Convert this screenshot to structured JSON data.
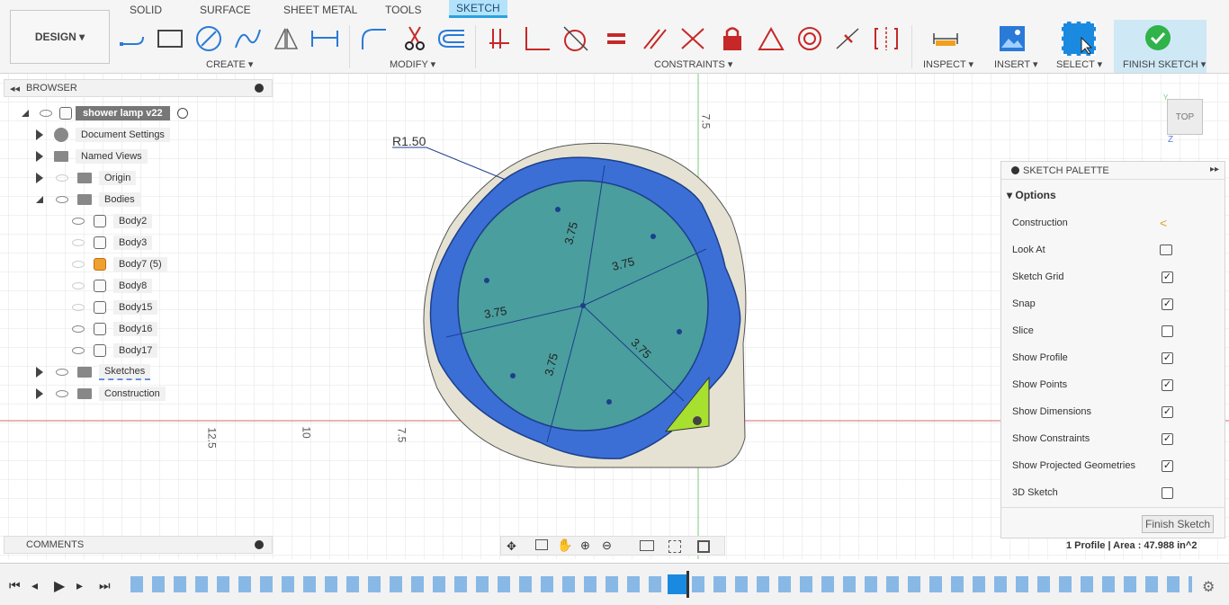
{
  "ribbon": {
    "workspace_button": "DESIGN ▾",
    "tabs": [
      "SOLID",
      "SURFACE",
      "SHEET METAL",
      "TOOLS",
      "SKETCH"
    ],
    "groups": {
      "create": "CREATE ▾",
      "modify": "MODIFY ▾",
      "constraints": "CONSTRAINTS ▾",
      "inspect": "INSPECT ▾",
      "insert": "INSERT ▾",
      "select": "SELECT ▾",
      "finish": "FINISH SKETCH ▾"
    }
  },
  "browser": {
    "title": "BROWSER",
    "root": "shower lamp v22",
    "items": [
      "Document Settings",
      "Named Views",
      "Origin",
      "Bodies"
    ],
    "bodies": [
      "Body2",
      "Body3",
      "Body7 (5)",
      "Body8",
      "Body15",
      "Body16",
      "Body17"
    ],
    "after": [
      "Sketches",
      "Construction"
    ]
  },
  "comments": {
    "title": "COMMENTS"
  },
  "canvas": {
    "radius_label": "R1.50",
    "dim_labels": [
      "3.75",
      "3.75",
      "3.75",
      "3.75",
      "3.75"
    ],
    "axis_labels": [
      "12.5",
      "10",
      "7.5",
      "7.5"
    ],
    "viewcube_label": "TOP",
    "viewcube_axes": [
      "Y",
      "Z"
    ]
  },
  "sketch_palette": {
    "title": "SKETCH PALETTE",
    "section": "Options",
    "rows": [
      {
        "label": "Construction",
        "type": "icon"
      },
      {
        "label": "Look At",
        "type": "icon"
      },
      {
        "label": "Sketch Grid",
        "checked": "✓"
      },
      {
        "label": "Snap",
        "checked": "✓"
      },
      {
        "label": "Slice",
        "checked": ""
      },
      {
        "label": "Show Profile",
        "checked": "✓"
      },
      {
        "label": "Show Points",
        "checked": "✓"
      },
      {
        "label": "Show Dimensions",
        "checked": "✓"
      },
      {
        "label": "Show Constraints",
        "checked": "✓"
      },
      {
        "label": "Show Projected Geometries",
        "checked": "✓"
      },
      {
        "label": "3D Sketch",
        "checked": ""
      }
    ],
    "finish_button": "Finish Sketch"
  },
  "status": {
    "profile_info": "1 Profile | Area : 47.988 in^2"
  },
  "colors": {
    "accent": "#2aa0e0",
    "profile_blue": "#3b6fd6",
    "profile_teal": "#4a9e9e",
    "body_beige": "#e6e2d3"
  }
}
